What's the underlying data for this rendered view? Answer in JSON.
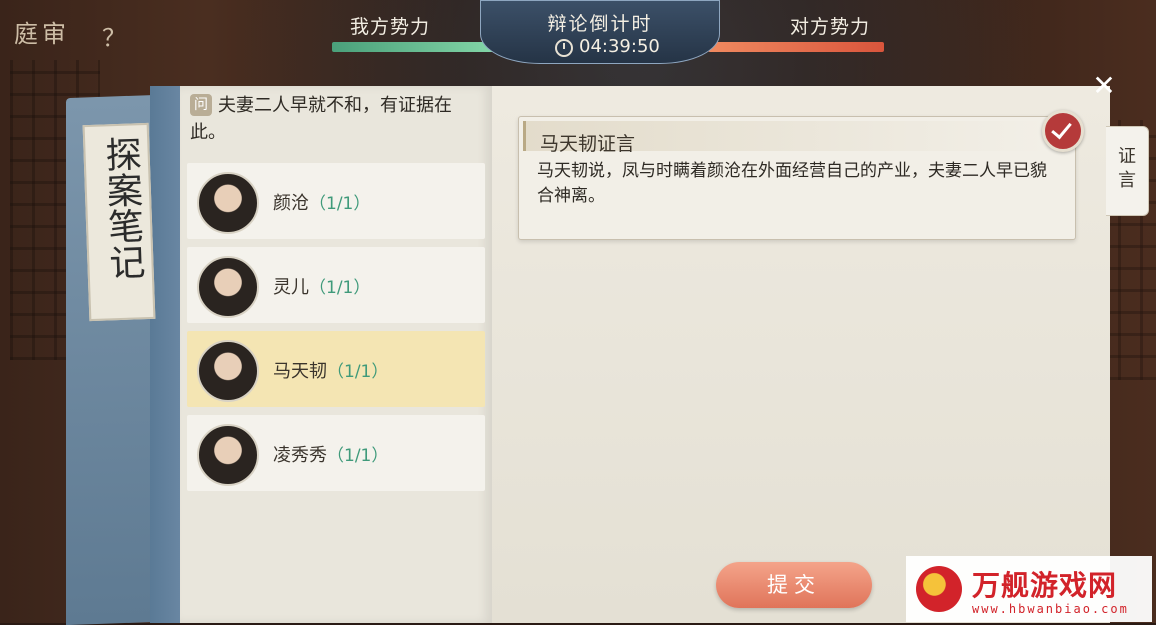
{
  "header": {
    "screen_title": "庭审",
    "help_icon": "？"
  },
  "hud": {
    "left_label": "我方势力",
    "right_label": "对方势力",
    "center_title": "辩论倒计时",
    "timer": "04:39:50"
  },
  "notebook": {
    "tag_label": "探案笔记",
    "question_badge": "问",
    "question_text": "夫妻二人早就不和，有证据在此。",
    "characters": [
      {
        "name": "颜沧",
        "count": "（1/1）",
        "selected": false
      },
      {
        "name": "灵儿",
        "count": "（1/1）",
        "selected": false
      },
      {
        "name": "马天韧",
        "count": "（1/1）",
        "selected": true
      },
      {
        "name": "凌秀秀",
        "count": "（1/1）",
        "selected": false
      }
    ]
  },
  "evidence": {
    "title": "马天韧证言",
    "text": "马天韧说，凤与时瞒着颜沧在外面经营自己的产业，夫妻二人早已貌合神离。",
    "tab_label": "证言"
  },
  "actions": {
    "submit_label": "提交"
  },
  "watermark": {
    "title": "万舰游戏网",
    "url": "www.hbwanbiao.com"
  }
}
